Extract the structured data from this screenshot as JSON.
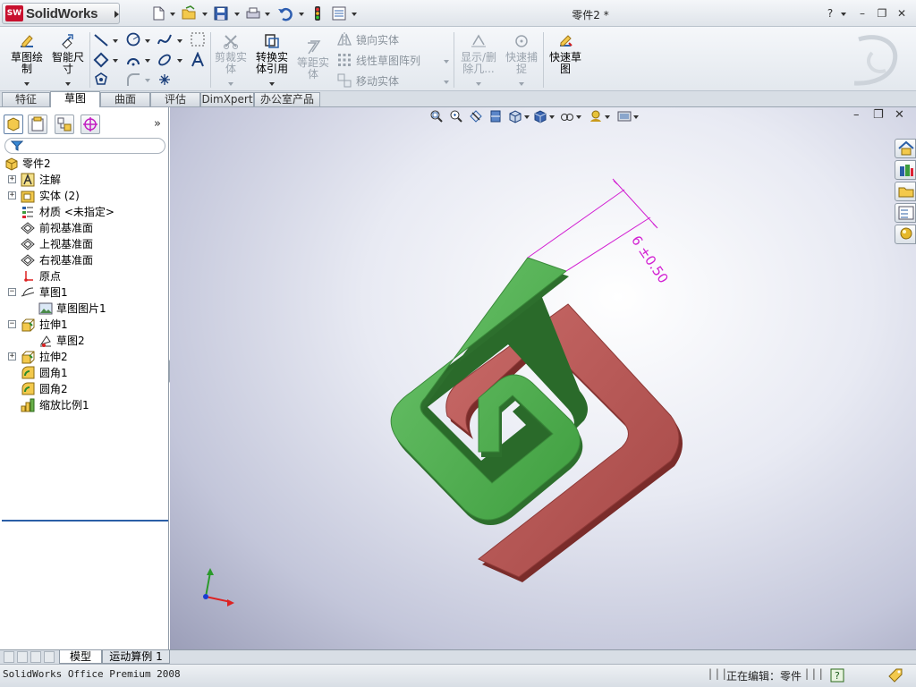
{
  "app": {
    "brand": "SolidWorks",
    "logo_mark": "SW",
    "document_title": "零件2 *",
    "help_label": "?"
  },
  "command_manager": {
    "sketch": "草图绘制",
    "smart_dimension": "智能尺寸",
    "trim_entities": "剪裁实体",
    "convert_entities": "转换实体引用",
    "offset_entities": "等距实体",
    "mirror_entities": "镜向实体",
    "linear_pattern": "线性草图阵列",
    "move_entities": "移动实体",
    "display_delete_relations": "显示/删除几...",
    "quick_snaps": "快速捕捉",
    "rapid_sketch": "快速草图"
  },
  "tabs": [
    {
      "label": "特征"
    },
    {
      "label": "草图"
    },
    {
      "label": "曲面"
    },
    {
      "label": "评估"
    },
    {
      "label": "DimXpert"
    },
    {
      "label": "办公室产品"
    }
  ],
  "feature_tree": {
    "root": "零件2",
    "items": [
      {
        "label": "注解",
        "icon": "annotations-icon"
      },
      {
        "label": "实体 (2)",
        "icon": "solid-bodies-icon"
      },
      {
        "label": "材质 <未指定>",
        "icon": "material-icon"
      },
      {
        "label": "前视基准面",
        "icon": "plane-icon"
      },
      {
        "label": "上视基准面",
        "icon": "plane-icon"
      },
      {
        "label": "右视基准面",
        "icon": "plane-icon"
      },
      {
        "label": "原点",
        "icon": "origin-icon"
      },
      {
        "label": "草图1",
        "icon": "sketch-icon"
      },
      {
        "label": "草图图片1",
        "icon": "sketch-picture-icon"
      },
      {
        "label": "拉伸1",
        "icon": "extrude-icon"
      },
      {
        "label": "草图2",
        "icon": "sketch-icon"
      },
      {
        "label": "拉伸2",
        "icon": "extrude-icon"
      },
      {
        "label": "圆角1",
        "icon": "fillet-icon"
      },
      {
        "label": "圆角2",
        "icon": "fillet-icon"
      },
      {
        "label": "缩放比例1",
        "icon": "scale-icon"
      }
    ]
  },
  "viewport": {
    "dimension_text": "6 ±0.50",
    "colors": {
      "green_body": "#5cb85c",
      "red_body": "#c0605e",
      "dimension": "#d21fd2"
    }
  },
  "bottom_tabs": {
    "model": "模型",
    "motion_study": "运动算例 1"
  },
  "status_bar": {
    "product": "SolidWorks Office Premium 2008",
    "separator1": "| | |",
    "editing": "正在编辑：零件",
    "separator2": "| | |"
  }
}
